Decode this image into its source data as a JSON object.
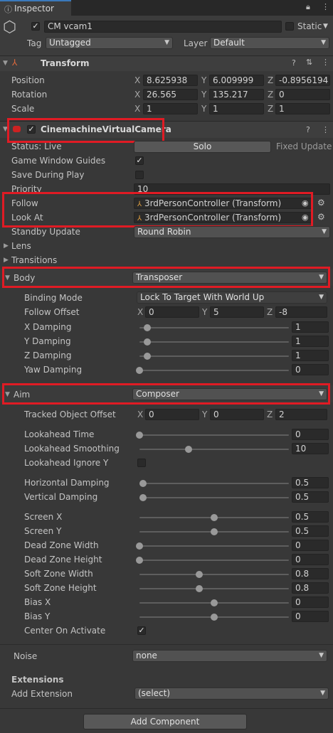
{
  "tab": {
    "title": "Inspector"
  },
  "object": {
    "name": "CM vcam1",
    "static_label": "Static",
    "tag_label": "Tag",
    "tag_value": "Untagged",
    "layer_label": "Layer",
    "layer_value": "Default"
  },
  "transform": {
    "title": "Transform",
    "position": {
      "label": "Position",
      "x": "8.625938",
      "y": "6.009999",
      "z": "-0.8956194"
    },
    "rotation": {
      "label": "Rotation",
      "x": "26.565",
      "y": "135.217",
      "z": "0"
    },
    "scale": {
      "label": "Scale",
      "x": "1",
      "y": "1",
      "z": "1"
    }
  },
  "axes": {
    "x": "X",
    "y": "Y",
    "z": "Z"
  },
  "vcam": {
    "title": "CinemachineVirtualCamera",
    "status_label": "Status: Live",
    "solo_label": "Solo",
    "fixed_update": "Fixed Update",
    "game_window_guides": "Game Window Guides",
    "save_during_play": "Save During Play",
    "priority_label": "Priority",
    "priority_value": "10",
    "follow_label": "Follow",
    "follow_value": "3rdPersonController (Transform)",
    "look_at_label": "Look At",
    "look_at_value": "3rdPersonController (Transform)",
    "standby_label": "Standby Update",
    "standby_value": "Round Robin",
    "lens_label": "Lens",
    "transitions_label": "Transitions"
  },
  "body": {
    "label": "Body",
    "value": "Transposer",
    "binding_mode_label": "Binding Mode",
    "binding_mode_value": "Lock To Target With World Up",
    "follow_offset_label": "Follow Offset",
    "follow_offset": {
      "x": "0",
      "y": "5",
      "z": "-8"
    },
    "sliders": [
      {
        "label": "X Damping",
        "value": "1",
        "fraction": 0.05
      },
      {
        "label": "Y Damping",
        "value": "1",
        "fraction": 0.05
      },
      {
        "label": "Z Damping",
        "value": "1",
        "fraction": 0.05
      },
      {
        "label": "Yaw Damping",
        "value": "0",
        "fraction": 0.0
      }
    ]
  },
  "aim": {
    "label": "Aim",
    "value": "Composer",
    "tracked_offset_label": "Tracked Object Offset",
    "tracked_offset": {
      "x": "0",
      "y": "0",
      "z": "2"
    },
    "lookahead_time_label": "Lookahead Time",
    "lookahead_time_value": "0",
    "lookahead_time_fraction": 0.0,
    "lookahead_smoothing_label": "Lookahead Smoothing",
    "lookahead_smoothing_value": "10",
    "lookahead_smoothing_fraction": 0.33,
    "lookahead_ignore_y_label": "Lookahead Ignore Y",
    "horizontal_damping_label": "Horizontal Damping",
    "horizontal_damping_value": "0.5",
    "horizontal_damping_fraction": 0.025,
    "vertical_damping_label": "Vertical Damping",
    "vertical_damping_value": "0.5",
    "vertical_damping_fraction": 0.025,
    "composition_sliders": [
      {
        "label": "Screen X",
        "value": "0.5",
        "fraction": 0.5
      },
      {
        "label": "Screen Y",
        "value": "0.5",
        "fraction": 0.5
      },
      {
        "label": "Dead Zone Width",
        "value": "0",
        "fraction": 0.0
      },
      {
        "label": "Dead Zone Height",
        "value": "0",
        "fraction": 0.0
      },
      {
        "label": "Soft Zone Width",
        "value": "0.8",
        "fraction": 0.4
      },
      {
        "label": "Soft Zone Height",
        "value": "0.8",
        "fraction": 0.4
      },
      {
        "label": "Bias X",
        "value": "0",
        "fraction": 0.5
      },
      {
        "label": "Bias Y",
        "value": "0",
        "fraction": 0.5
      }
    ],
    "center_on_activate_label": "Center On Activate"
  },
  "noise": {
    "label": "Noise",
    "value": "none"
  },
  "extensions": {
    "title": "Extensions",
    "add_label": "Add Extension",
    "add_value": "(select)"
  },
  "add_component": "Add Component",
  "colors": {
    "highlight": "#e01b24",
    "background": "#383838"
  }
}
